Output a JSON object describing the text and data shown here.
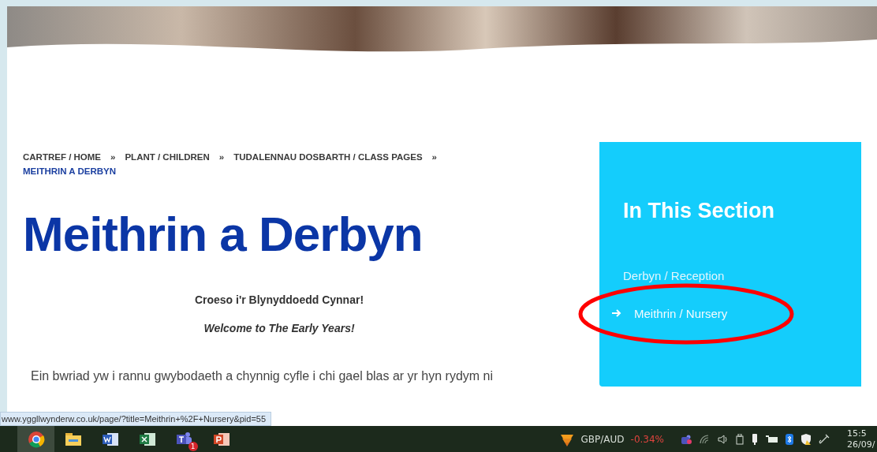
{
  "breadcrumb": [
    {
      "label": "CARTREF / HOME",
      "current": false
    },
    {
      "label": "PLANT / CHILDREN",
      "current": false
    },
    {
      "label": "TUDALENNAU DOSBARTH / CLASS PAGES",
      "current": false
    },
    {
      "label": "MEITHRIN A DERBYN",
      "current": true
    }
  ],
  "breadcrumb_separator": "»",
  "title": "Meithrin a Derbyn",
  "welcome_welsh": "Croeso i'r Blynyddoedd Cynnar!",
  "welcome_english": "Welcome to The Early Years!",
  "intro": "Ein bwriad yw i rannu gwybodaeth a chynnig cyfle i chi gael blas ar yr hyn rydym ni",
  "sidebar": {
    "heading": "In This Section",
    "items": [
      {
        "label": "Derbyn / Reception",
        "selected": false
      },
      {
        "label": "Meithrin / Nursery",
        "selected": true
      }
    ]
  },
  "status_url": "www.yggllwynderw.co.uk/page/?title=Meithrin+%2F+Nursery&pid=55",
  "taskbar": {
    "apps": [
      {
        "kind": "chrome",
        "active": true
      },
      {
        "kind": "explorer",
        "active": false
      },
      {
        "kind": "word",
        "active": false
      },
      {
        "kind": "excel",
        "active": false
      },
      {
        "kind": "teams",
        "active": false,
        "badge": "1"
      },
      {
        "kind": "powerpoint",
        "active": false
      }
    ],
    "ticker": {
      "pair": "GBP/AUD",
      "change": "-0.34%"
    },
    "time": "15:5",
    "date": "26/09/"
  }
}
